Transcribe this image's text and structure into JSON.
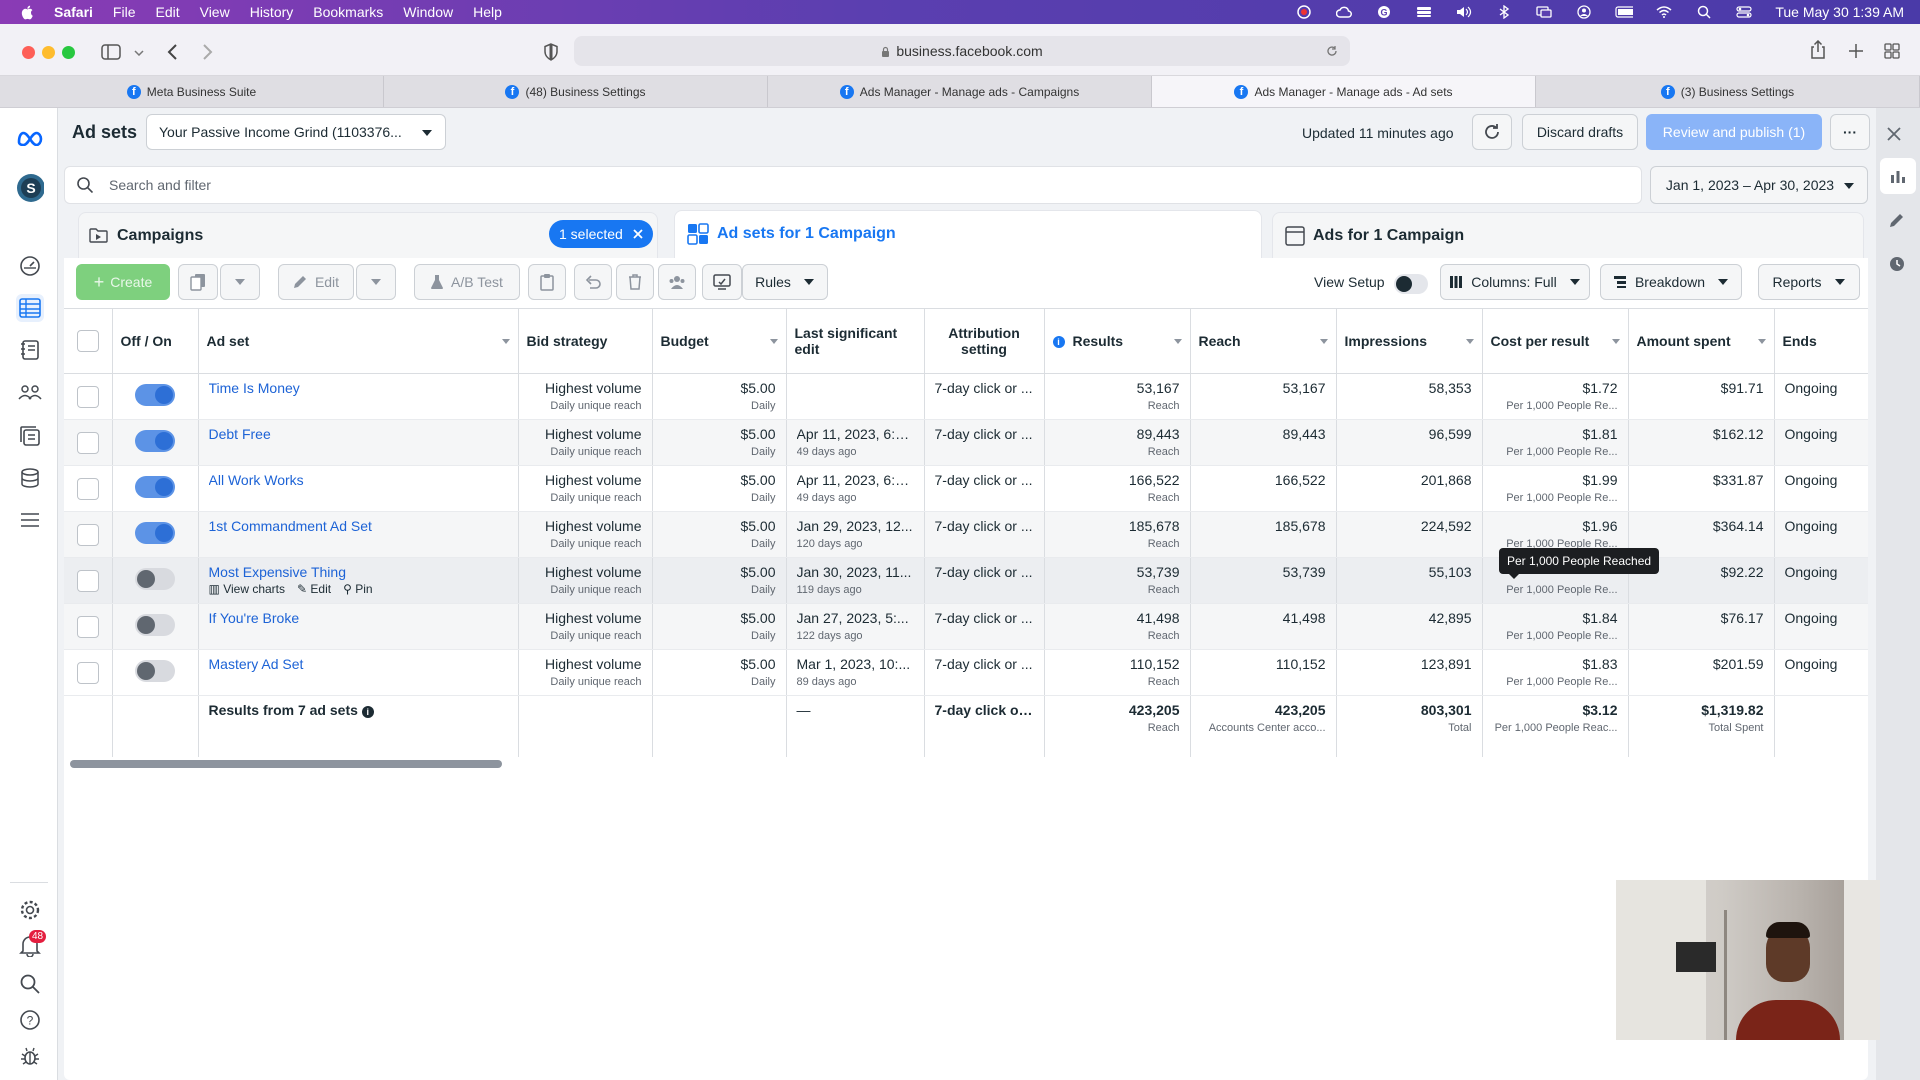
{
  "menubar": {
    "app": "Safari",
    "items": [
      "File",
      "Edit",
      "View",
      "History",
      "Bookmarks",
      "Window",
      "Help"
    ],
    "clock": "Tue May 30  1:39 AM"
  },
  "browser": {
    "url": "business.facebook.com",
    "tabs": [
      "Meta Business Suite",
      "(48) Business Settings",
      "Ads Manager - Manage ads - Campaigns",
      "Ads Manager - Manage ads - Ad sets",
      "(3) Business Settings"
    ]
  },
  "nav": {
    "notifications": "48"
  },
  "header": {
    "title": "Ad sets",
    "account": "Your Passive Income Grind (1103376...",
    "updated": "Updated 11 minutes ago",
    "discard": "Discard drafts",
    "publish": "Review and publish (1)",
    "more": "···"
  },
  "search": {
    "placeholder": "Search and filter",
    "date_range": "Jan 1, 2023 – Apr 30, 2023"
  },
  "level_tabs": {
    "campaigns": "Campaigns",
    "selected": "1 selected",
    "adsets": "Ad sets for 1 Campaign",
    "ads": "Ads for 1 Campaign"
  },
  "toolbar": {
    "create": "Create",
    "edit": "Edit",
    "abtest": "A/B Test",
    "rules": "Rules",
    "view_setup": "View Setup",
    "columns": "Columns: Full",
    "breakdown": "Breakdown",
    "reports": "Reports"
  },
  "columns": [
    "Off / On",
    "Ad set",
    "Bid strategy",
    "Budget",
    "Last significant edit",
    "Attribution setting",
    "Results",
    "Reach",
    "Impressions",
    "Cost per result",
    "Amount spent",
    "Ends"
  ],
  "rows": [
    {
      "on": true,
      "name": "Time Is Money",
      "bid": "Highest volume",
      "bid_sub": "Daily unique reach",
      "budget": "$5.00",
      "budget_sub": "Daily",
      "edit": "",
      "edit_sub": "",
      "attr": "7-day click or ...",
      "results": "53,167",
      "results_sub": "Reach",
      "reach": "53,167",
      "impr": "58,353",
      "cpr": "$1.72",
      "cpr_sub": "Per 1,000 People Re...",
      "spent": "$91.71",
      "ends": "Ongoing"
    },
    {
      "on": true,
      "name": "Debt Free",
      "bid": "Highest volume",
      "bid_sub": "Daily unique reach",
      "budget": "$5.00",
      "budget_sub": "Daily",
      "edit": "Apr 11, 2023, 6:5...",
      "edit_sub": "49 days ago",
      "attr": "7-day click or ...",
      "results": "89,443",
      "results_sub": "Reach",
      "reach": "89,443",
      "impr": "96,599",
      "cpr": "$1.81",
      "cpr_sub": "Per 1,000 People Re...",
      "spent": "$162.12",
      "ends": "Ongoing"
    },
    {
      "on": true,
      "name": "All Work Works",
      "bid": "Highest volume",
      "bid_sub": "Daily unique reach",
      "budget": "$5.00",
      "budget_sub": "Daily",
      "edit": "Apr 11, 2023, 6:5...",
      "edit_sub": "49 days ago",
      "attr": "7-day click or ...",
      "results": "166,522",
      "results_sub": "Reach",
      "reach": "166,522",
      "impr": "201,868",
      "cpr": "$1.99",
      "cpr_sub": "Per 1,000 People Re...",
      "spent": "$331.87",
      "ends": "Ongoing"
    },
    {
      "on": true,
      "name": "1st Commandment Ad Set",
      "bid": "Highest volume",
      "bid_sub": "Daily unique reach",
      "budget": "$5.00",
      "budget_sub": "Daily",
      "edit": "Jan 29, 2023, 12...",
      "edit_sub": "120 days ago",
      "attr": "7-day click or ...",
      "results": "185,678",
      "results_sub": "Reach",
      "reach": "185,678",
      "impr": "224,592",
      "cpr": "$1.96",
      "cpr_sub": "Per 1,000 People Re...",
      "spent": "$364.14",
      "ends": "Ongoing"
    },
    {
      "on": false,
      "name": "Most Expensive Thing",
      "bid": "Highest volume",
      "bid_sub": "Daily unique reach",
      "budget": "$5.00",
      "budget_sub": "Daily",
      "edit": "Jan 30, 2023, 11...",
      "edit_sub": "119 days ago",
      "attr": "7-day click or ...",
      "results": "53,739",
      "results_sub": "Reach",
      "reach": "53,739",
      "impr": "55,103",
      "cpr": "",
      "cpr_sub": "Per 1,000 People Re...",
      "spent": "$92.22",
      "ends": "Ongoing",
      "actions": [
        "View charts",
        "Edit",
        "Pin"
      ]
    },
    {
      "on": false,
      "name": "If You're Broke",
      "bid": "Highest volume",
      "bid_sub": "Daily unique reach",
      "budget": "$5.00",
      "budget_sub": "Daily",
      "edit": "Jan 27, 2023, 5:...",
      "edit_sub": "122 days ago",
      "attr": "7-day click or ...",
      "results": "41,498",
      "results_sub": "Reach",
      "reach": "41,498",
      "impr": "42,895",
      "cpr": "$1.84",
      "cpr_sub": "Per 1,000 People Re...",
      "spent": "$76.17",
      "ends": "Ongoing"
    },
    {
      "on": false,
      "name": "Mastery Ad Set",
      "bid": "Highest volume",
      "bid_sub": "Daily unique reach",
      "budget": "$5.00",
      "budget_sub": "Daily",
      "edit": "Mar 1, 2023, 10:...",
      "edit_sub": "89 days ago",
      "attr": "7-day click or ...",
      "results": "110,152",
      "results_sub": "Reach",
      "reach": "110,152",
      "impr": "123,891",
      "cpr": "$1.83",
      "cpr_sub": "Per 1,000 People Re...",
      "spent": "$201.59",
      "ends": "Ongoing"
    }
  ],
  "totals": {
    "label": "Results from 7 ad sets",
    "edit": "—",
    "attr": "7-day click or ...",
    "results": "423,205",
    "results_sub": "Reach",
    "reach": "423,205",
    "reach_sub": "Accounts Center acco...",
    "impr": "803,301",
    "impr_sub": "Total",
    "cpr": "$3.12",
    "cpr_sub": "Per 1,000 People Reac...",
    "spent": "$1,319.82",
    "spent_sub": "Total Spent"
  },
  "tooltip": "Per 1,000 People Reached",
  "colors": {
    "accent": "#1877f2",
    "publish": "#8ab4f8",
    "create": "#7ed07e",
    "selected_pill": "#1877f2"
  }
}
